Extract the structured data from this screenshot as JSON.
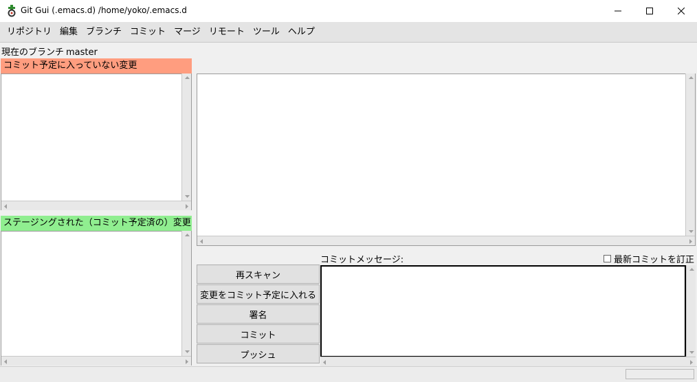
{
  "window": {
    "title": "Git Gui (.emacs.d) /home/yoko/.emacs.d",
    "icon": "git-gui-icon",
    "controls": [
      "minimize-icon",
      "maximize-icon",
      "close-icon"
    ]
  },
  "menu": {
    "items": [
      {
        "label": "リポジトリ"
      },
      {
        "label": "編集"
      },
      {
        "label": "ブランチ"
      },
      {
        "label": "コミット"
      },
      {
        "label": "マージ"
      },
      {
        "label": "リモート"
      },
      {
        "label": "ツール"
      },
      {
        "label": "ヘルプ"
      }
    ]
  },
  "branch": {
    "prefix": "現在のブランチ",
    "name": "master"
  },
  "unstaged": {
    "title": "コミット予定に入っていない変更",
    "color": "#ff9d7f"
  },
  "staged": {
    "title": "ステージングされた（コミット予定済の）変更",
    "color": "#90ee90"
  },
  "diff": {
    "color": "#ffd500"
  },
  "commit": {
    "message_label": "コミットメッセージ:",
    "amend_label": "最新コミットを訂正",
    "amend_checked": false,
    "buttons": [
      {
        "label": "再スキャン"
      },
      {
        "label": "変更をコミット予定に入れる"
      },
      {
        "label": "署名"
      },
      {
        "label": "コミット"
      },
      {
        "label": "プッシュ"
      }
    ]
  }
}
